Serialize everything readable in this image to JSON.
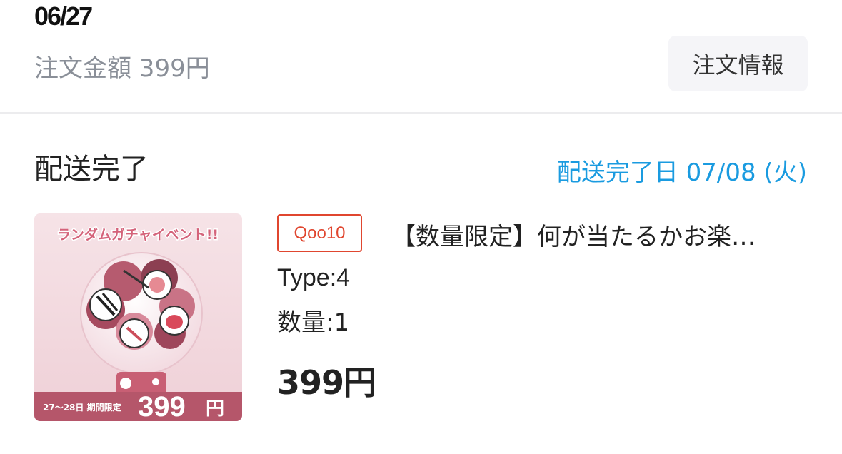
{
  "order": {
    "date": "06/27",
    "amount_text": "注文金額 399円",
    "info_button_label": "注文情報"
  },
  "shipment": {
    "status": "配送完了",
    "delivered_date_text": "配送完了日 07/08 (火)"
  },
  "product": {
    "seller_badge": "Qoo10",
    "title": "【数量限定】何が当たるかお楽…",
    "type_text": "Type:4",
    "quantity_text": "数量:1",
    "price_text": "399円",
    "thumbnail": {
      "banner": "ランダムガチャイベント!!",
      "period": "27〜28日 期間限定",
      "price": "399",
      "currency": "円"
    }
  },
  "colors": {
    "accent_blue": "#1a9be0",
    "badge_red": "#e0462f",
    "thumb_pink": "#f3d6dc",
    "thumb_banner": "#d4637a",
    "thumb_price_bar": "#b5566a"
  }
}
